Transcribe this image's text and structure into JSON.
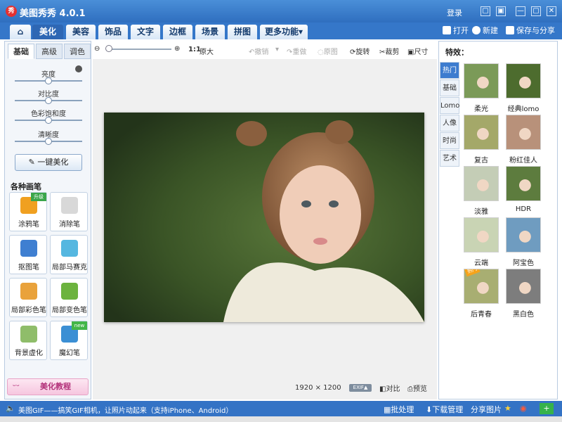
{
  "app": {
    "title": "美图秀秀 4.0.1",
    "logo_text": "秀",
    "login": "登录"
  },
  "window_buttons": [
    "▢",
    "▣",
    "—",
    "▢",
    "✕"
  ],
  "main_tabs": [
    "美化",
    "美容",
    "饰品",
    "文字",
    "边框",
    "场景",
    "拼图",
    "更多功能"
  ],
  "home_icon": "home-icon",
  "header_actions": {
    "open": "打开",
    "new": "新建",
    "save": "保存与分享"
  },
  "left_panel": {
    "tabs": [
      "基础",
      "高级",
      "调色"
    ],
    "sliders": [
      {
        "label": "亮度",
        "value": 0.5
      },
      {
        "label": "对比度",
        "value": 0.5
      },
      {
        "label": "色彩饱和度",
        "value": 0.5
      },
      {
        "label": "清晰度",
        "value": 0.5
      }
    ],
    "one_click": "一键美化",
    "brushes_title": "各种画笔",
    "brushes": [
      {
        "label": "涂鸦笔",
        "badge": "升级",
        "icon": "pencil-icon",
        "color": "#f0a020"
      },
      {
        "label": "消除笔",
        "badge": "",
        "icon": "eraser-icon",
        "color": "#d8d8d8"
      },
      {
        "label": "抠图笔",
        "badge": "",
        "icon": "pen-icon",
        "color": "#3f7fd1"
      },
      {
        "label": "局部马赛克",
        "badge": "",
        "icon": "mosaic-icon",
        "color": "#55b7e0"
      },
      {
        "label": "局部彩色笔",
        "badge": "",
        "icon": "brush-icon",
        "color": "#e9a23b"
      },
      {
        "label": "局部变色笔",
        "badge": "",
        "icon": "color-bucket-icon",
        "color": "#6cb33e"
      },
      {
        "label": "背景虚化",
        "badge": "",
        "icon": "blur-icon",
        "color": "#8fbd6a"
      },
      {
        "label": "魔幻笔",
        "badge": "new",
        "icon": "magic-wand-icon",
        "color": "#3b8fd4"
      }
    ],
    "tutorial": "美化教程"
  },
  "canvas_toolbar": {
    "ratio": "1:1",
    "original_size": "原大",
    "undo": "撤销",
    "redo": "重做",
    "origin": "原图",
    "rotate": "旋转",
    "crop": "裁剪",
    "size": "尺寸"
  },
  "canvas_status": {
    "dims": "1920 × 1200",
    "exif": "EXIF▲",
    "compare": "对比",
    "preview": "预览"
  },
  "effects_panel": {
    "title": "特效：",
    "categories": [
      "热门",
      "基础",
      "Lomo",
      "人像",
      "时尚",
      "艺术"
    ],
    "effects": [
      {
        "label": "柔光",
        "color": "#7b9a58",
        "hot": ""
      },
      {
        "label": "经典lomo",
        "color": "#4d6c2e",
        "hot": ""
      },
      {
        "label": "复古",
        "color": "#a4a869",
        "hot": ""
      },
      {
        "label": "粉红佳人",
        "color": "#b8917a",
        "hot": ""
      },
      {
        "label": "淡雅",
        "color": "#c4cdb6",
        "hot": ""
      },
      {
        "label": "HDR",
        "color": "#5d7c3e",
        "hot": ""
      },
      {
        "label": "云端",
        "color": "#c9d4b4",
        "hot": ""
      },
      {
        "label": "阿宝色",
        "color": "#6f9cc0",
        "hot": ""
      },
      {
        "label": "后青春",
        "color": "#a8ae72",
        "hot": "热门"
      },
      {
        "label": "黑白色",
        "color": "#7d7d7d",
        "hot": ""
      }
    ]
  },
  "bottom_bar": {
    "text": "美图GIF——搞笑GIF相机，让照片动起来（支持iPhone、Android）",
    "batch": "批处理",
    "download": "下载管理",
    "share": "分享图片"
  }
}
